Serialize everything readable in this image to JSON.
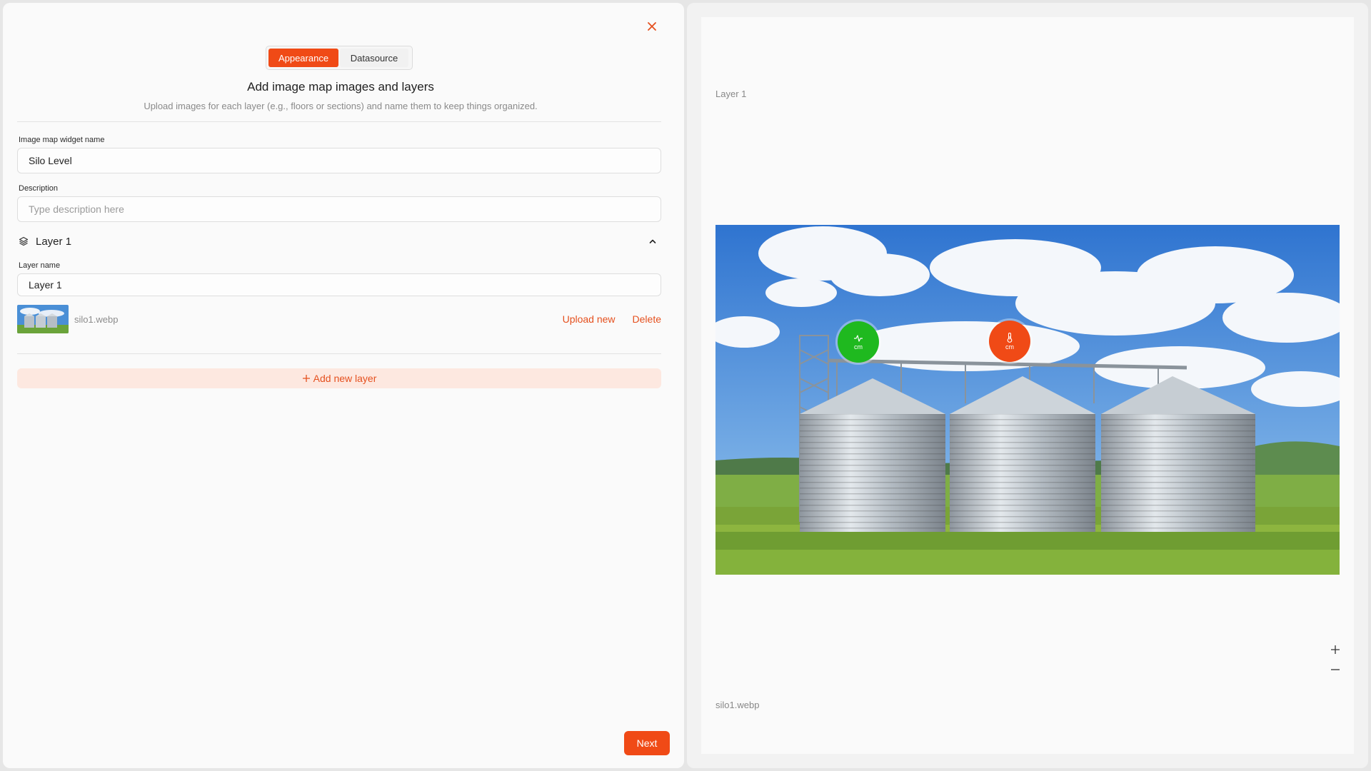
{
  "editor": {
    "tabs": [
      {
        "label": "Appearance",
        "active": true
      },
      {
        "label": "Datasource",
        "active": false
      }
    ],
    "heading": "Add image map images and layers",
    "subheading": "Upload images for each layer (e.g., floors or sections) and name them to keep things organized.",
    "widget_name_label": "Image map widget name",
    "widget_name_value": "Silo Level",
    "description_label": "Description",
    "description_placeholder": "Type description here",
    "layer": {
      "title": "Layer 1",
      "name_label": "Layer name",
      "name_value": "Layer 1",
      "file_name": "silo1.webp",
      "upload_label": "Upload new",
      "delete_label": "Delete"
    },
    "add_layer_label": "Add new layer",
    "next_label": "Next"
  },
  "preview": {
    "layer_caption": "Layer 1",
    "file_caption": "silo1.webp",
    "markers": [
      {
        "icon": "pulse-icon",
        "unit": "cm",
        "color": "#1fb91f"
      },
      {
        "icon": "thermometer-icon",
        "unit": "cm",
        "color": "#f04a16"
      }
    ]
  },
  "colors": {
    "accent": "#f04a16",
    "accent_soft": "#fde8e0",
    "success": "#1fb91f"
  }
}
